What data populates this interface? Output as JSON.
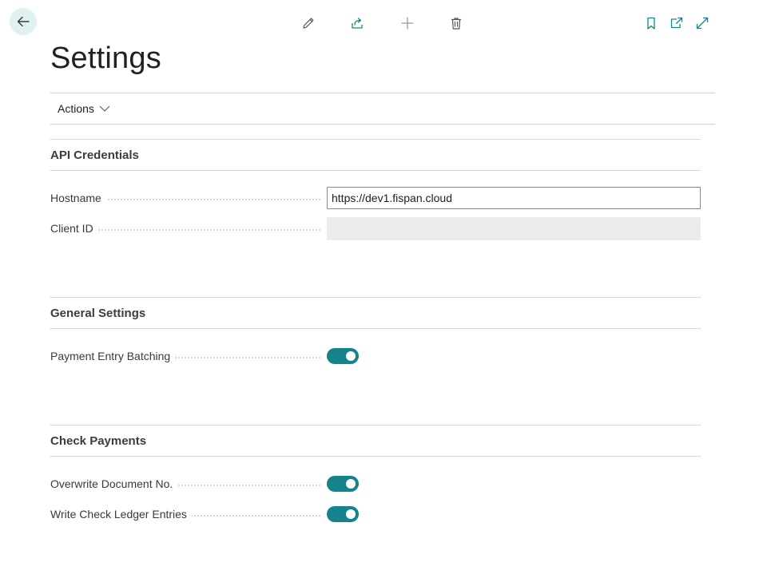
{
  "header": {
    "title": "Settings",
    "actions_label": "Actions"
  },
  "toolbar": {
    "icons": [
      "back-arrow-icon",
      "edit-pencil-icon",
      "share-icon",
      "new-plus-icon",
      "delete-trash-icon",
      "bookmark-icon",
      "open-new-window-icon",
      "expand-icon"
    ]
  },
  "sections": {
    "api": {
      "title": "API Credentials",
      "hostname_label": "Hostname",
      "hostname_value": "https://dev1.fispan.cloud",
      "client_id_label": "Client ID",
      "client_id_value": ""
    },
    "general": {
      "title": "General Settings",
      "payment_entry_batching_label": "Payment Entry Batching",
      "payment_entry_batching_on": true
    },
    "check": {
      "title": "Check Payments",
      "overwrite_doc_no_label": "Overwrite Document No.",
      "overwrite_doc_no_on": true,
      "write_check_ledger_label": "Write Check Ledger Entries",
      "write_check_ledger_on": true
    }
  },
  "colors": {
    "accent": "#14838b",
    "back_button_bg": "#dff1f1",
    "readonly_field_bg": "#ebebeb"
  }
}
